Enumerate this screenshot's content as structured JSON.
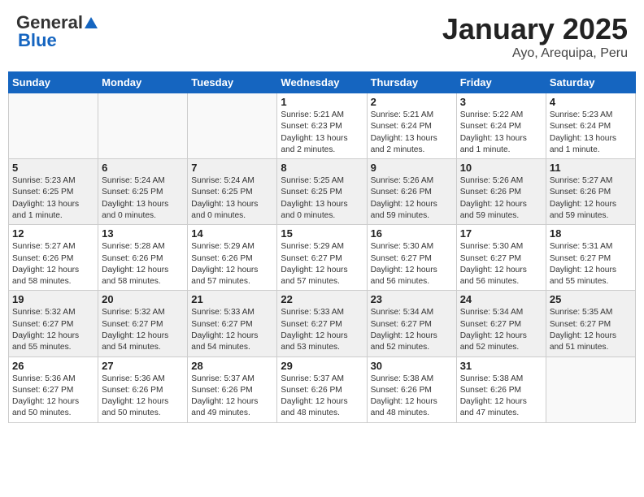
{
  "header": {
    "logo_general": "General",
    "logo_blue": "Blue",
    "month": "January 2025",
    "location": "Ayo, Arequipa, Peru"
  },
  "weekdays": [
    "Sunday",
    "Monday",
    "Tuesday",
    "Wednesday",
    "Thursday",
    "Friday",
    "Saturday"
  ],
  "weeks": [
    {
      "shaded": false,
      "days": [
        {
          "num": "",
          "info": ""
        },
        {
          "num": "",
          "info": ""
        },
        {
          "num": "",
          "info": ""
        },
        {
          "num": "1",
          "info": "Sunrise: 5:21 AM\nSunset: 6:23 PM\nDaylight: 13 hours\nand 2 minutes."
        },
        {
          "num": "2",
          "info": "Sunrise: 5:21 AM\nSunset: 6:24 PM\nDaylight: 13 hours\nand 2 minutes."
        },
        {
          "num": "3",
          "info": "Sunrise: 5:22 AM\nSunset: 6:24 PM\nDaylight: 13 hours\nand 1 minute."
        },
        {
          "num": "4",
          "info": "Sunrise: 5:23 AM\nSunset: 6:24 PM\nDaylight: 13 hours\nand 1 minute."
        }
      ]
    },
    {
      "shaded": true,
      "days": [
        {
          "num": "5",
          "info": "Sunrise: 5:23 AM\nSunset: 6:25 PM\nDaylight: 13 hours\nand 1 minute."
        },
        {
          "num": "6",
          "info": "Sunrise: 5:24 AM\nSunset: 6:25 PM\nDaylight: 13 hours\nand 0 minutes."
        },
        {
          "num": "7",
          "info": "Sunrise: 5:24 AM\nSunset: 6:25 PM\nDaylight: 13 hours\nand 0 minutes."
        },
        {
          "num": "8",
          "info": "Sunrise: 5:25 AM\nSunset: 6:25 PM\nDaylight: 13 hours\nand 0 minutes."
        },
        {
          "num": "9",
          "info": "Sunrise: 5:26 AM\nSunset: 6:26 PM\nDaylight: 12 hours\nand 59 minutes."
        },
        {
          "num": "10",
          "info": "Sunrise: 5:26 AM\nSunset: 6:26 PM\nDaylight: 12 hours\nand 59 minutes."
        },
        {
          "num": "11",
          "info": "Sunrise: 5:27 AM\nSunset: 6:26 PM\nDaylight: 12 hours\nand 59 minutes."
        }
      ]
    },
    {
      "shaded": false,
      "days": [
        {
          "num": "12",
          "info": "Sunrise: 5:27 AM\nSunset: 6:26 PM\nDaylight: 12 hours\nand 58 minutes."
        },
        {
          "num": "13",
          "info": "Sunrise: 5:28 AM\nSunset: 6:26 PM\nDaylight: 12 hours\nand 58 minutes."
        },
        {
          "num": "14",
          "info": "Sunrise: 5:29 AM\nSunset: 6:26 PM\nDaylight: 12 hours\nand 57 minutes."
        },
        {
          "num": "15",
          "info": "Sunrise: 5:29 AM\nSunset: 6:27 PM\nDaylight: 12 hours\nand 57 minutes."
        },
        {
          "num": "16",
          "info": "Sunrise: 5:30 AM\nSunset: 6:27 PM\nDaylight: 12 hours\nand 56 minutes."
        },
        {
          "num": "17",
          "info": "Sunrise: 5:30 AM\nSunset: 6:27 PM\nDaylight: 12 hours\nand 56 minutes."
        },
        {
          "num": "18",
          "info": "Sunrise: 5:31 AM\nSunset: 6:27 PM\nDaylight: 12 hours\nand 55 minutes."
        }
      ]
    },
    {
      "shaded": true,
      "days": [
        {
          "num": "19",
          "info": "Sunrise: 5:32 AM\nSunset: 6:27 PM\nDaylight: 12 hours\nand 55 minutes."
        },
        {
          "num": "20",
          "info": "Sunrise: 5:32 AM\nSunset: 6:27 PM\nDaylight: 12 hours\nand 54 minutes."
        },
        {
          "num": "21",
          "info": "Sunrise: 5:33 AM\nSunset: 6:27 PM\nDaylight: 12 hours\nand 54 minutes."
        },
        {
          "num": "22",
          "info": "Sunrise: 5:33 AM\nSunset: 6:27 PM\nDaylight: 12 hours\nand 53 minutes."
        },
        {
          "num": "23",
          "info": "Sunrise: 5:34 AM\nSunset: 6:27 PM\nDaylight: 12 hours\nand 52 minutes."
        },
        {
          "num": "24",
          "info": "Sunrise: 5:34 AM\nSunset: 6:27 PM\nDaylight: 12 hours\nand 52 minutes."
        },
        {
          "num": "25",
          "info": "Sunrise: 5:35 AM\nSunset: 6:27 PM\nDaylight: 12 hours\nand 51 minutes."
        }
      ]
    },
    {
      "shaded": false,
      "days": [
        {
          "num": "26",
          "info": "Sunrise: 5:36 AM\nSunset: 6:27 PM\nDaylight: 12 hours\nand 50 minutes."
        },
        {
          "num": "27",
          "info": "Sunrise: 5:36 AM\nSunset: 6:26 PM\nDaylight: 12 hours\nand 50 minutes."
        },
        {
          "num": "28",
          "info": "Sunrise: 5:37 AM\nSunset: 6:26 PM\nDaylight: 12 hours\nand 49 minutes."
        },
        {
          "num": "29",
          "info": "Sunrise: 5:37 AM\nSunset: 6:26 PM\nDaylight: 12 hours\nand 48 minutes."
        },
        {
          "num": "30",
          "info": "Sunrise: 5:38 AM\nSunset: 6:26 PM\nDaylight: 12 hours\nand 48 minutes."
        },
        {
          "num": "31",
          "info": "Sunrise: 5:38 AM\nSunset: 6:26 PM\nDaylight: 12 hours\nand 47 minutes."
        },
        {
          "num": "",
          "info": ""
        }
      ]
    }
  ]
}
